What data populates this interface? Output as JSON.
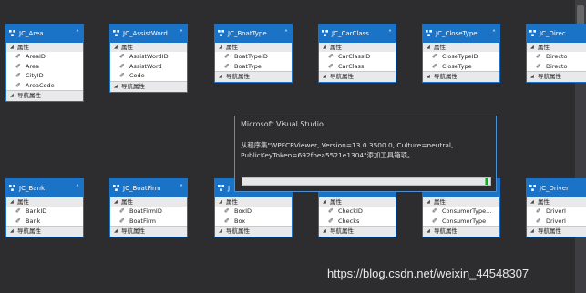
{
  "diagram": {
    "entities": [
      {
        "name": "JC_Area",
        "properties": [
          "AreaID",
          "Area",
          "CityID",
          "AreaCode"
        ]
      },
      {
        "name": "JC_AssistWord",
        "properties": [
          "AssistWordID",
          "AssistWord",
          "Code"
        ]
      },
      {
        "name": "JC_BoatType",
        "properties": [
          "BoatTypeID",
          "BoatType"
        ]
      },
      {
        "name": "JC_CarClass",
        "properties": [
          "CarClassID",
          "CarClass"
        ]
      },
      {
        "name": "JC_CloseType",
        "properties": [
          "CloseTypeID",
          "CloseType"
        ]
      },
      {
        "name": "JC_Direc",
        "properties": [
          "Directo",
          "Directo"
        ]
      },
      {
        "name": "JC_Bank",
        "properties": [
          "BankID",
          "Bank"
        ]
      },
      {
        "name": "JC_BoatFirm",
        "properties": [
          "BoatFirmID",
          "BoatFirm"
        ]
      },
      {
        "name": "J",
        "properties": [
          "BoxID",
          "Box"
        ]
      },
      {
        "name": "",
        "properties": [
          "CheckID",
          "Checks"
        ]
      },
      {
        "name": "",
        "properties": [
          "ConsumerType...",
          "ConsumerType"
        ]
      },
      {
        "name": "JC_Driver",
        "properties": [
          "DriverI",
          "DriverI"
        ]
      }
    ],
    "section_properties_label": "属性",
    "section_nav_label": "导航属性"
  },
  "dialog": {
    "title": "Microsoft Visual Studio",
    "message": "从程序集\"WPFCRViewer, Version=13.0.3500.0, Culture=neutral, PublicKeyToken=692fbea5521e1304\"添加工具箱项。",
    "progress": 0.99
  },
  "watermark": "https://blog.csdn.net/weixin_44548307",
  "colors": {
    "entity_header": "#1b73c7",
    "progress": "#06b025",
    "background": "#2d2d30"
  }
}
